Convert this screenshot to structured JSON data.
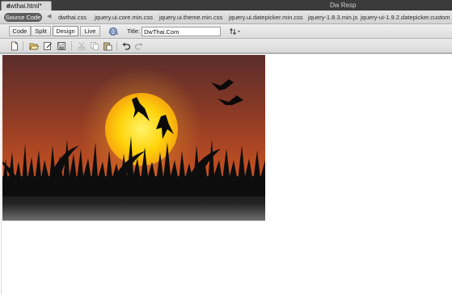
{
  "document_tab": {
    "filename": "dwthai.html*",
    "close": "×"
  },
  "app_title": "Dw Resp",
  "related_files": {
    "source_label": "Source Code",
    "files": [
      "dwthai.css",
      "jquery.ui.core.min.css",
      "jquery.ui.theme.min.css",
      "jquery.ui.datepicker.min.css",
      "jquery-1.8.3.min.js",
      "jquery-ui-1.9.2.datepicker.custom"
    ]
  },
  "document_toolbar": {
    "views": [
      {
        "label": "Code",
        "active": false
      },
      {
        "label": "Split",
        "active": false
      },
      {
        "label": "Design",
        "active": true
      },
      {
        "label": "Live",
        "active": false
      }
    ],
    "title_label": "Title:",
    "title_value": "DwThai.Com"
  },
  "standard_toolbar": {
    "icons": [
      "new-document-icon",
      "open-icon",
      "browse-in-bridge-icon",
      "save-icon",
      "save-all-icon",
      "cut-icon",
      "copy-icon",
      "paste-icon",
      "undo-icon",
      "redo-icon"
    ]
  },
  "design_view": {
    "image_subject": "sunset-with-birds-and-grass",
    "colors": {
      "sky_top": "#5e2f2a",
      "sky_mid": "#b84a23",
      "sky_low": "#d96a1e",
      "sun": "#ffd20a",
      "ground": "#111111"
    }
  }
}
